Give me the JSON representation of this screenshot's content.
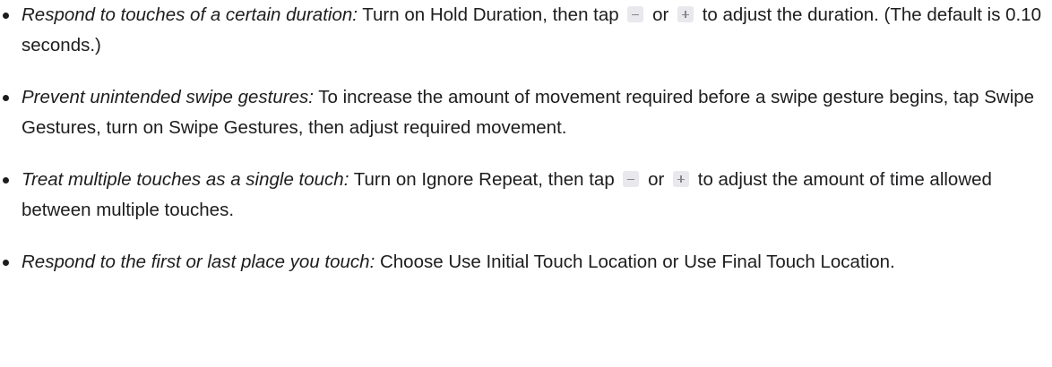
{
  "items": [
    {
      "lead_in": "Respond to touches of a certain duration:",
      "text_before_minus": " Turn on Hold Duration, then tap ",
      "between_text": " or ",
      "text_after_plus": " to adjust the duration. (The default is 0.10 seconds.)"
    },
    {
      "lead_in": "Prevent unintended swipe gestures:",
      "text": " To increase the amount of movement required before a swipe gesture begins, tap Swipe Gestures, turn on Swipe Gestures, then adjust required movement."
    },
    {
      "lead_in": "Treat multiple touches as a single touch:",
      "text_before_minus": " Turn on Ignore Repeat, then tap ",
      "between_text": " or ",
      "text_after_plus": " to adjust the amount of time allowed between multiple touches."
    },
    {
      "lead_in": "Respond to the first or last place you touch:",
      "text": " Choose Use Initial Touch Location or Use Final Touch Location."
    }
  ],
  "icons": {
    "minus": "minus-button-icon",
    "plus": "plus-button-icon"
  },
  "colors": {
    "text": "#1d1d1f",
    "button_bg": "#e8e8ed",
    "button_glyph": "#86868b"
  }
}
